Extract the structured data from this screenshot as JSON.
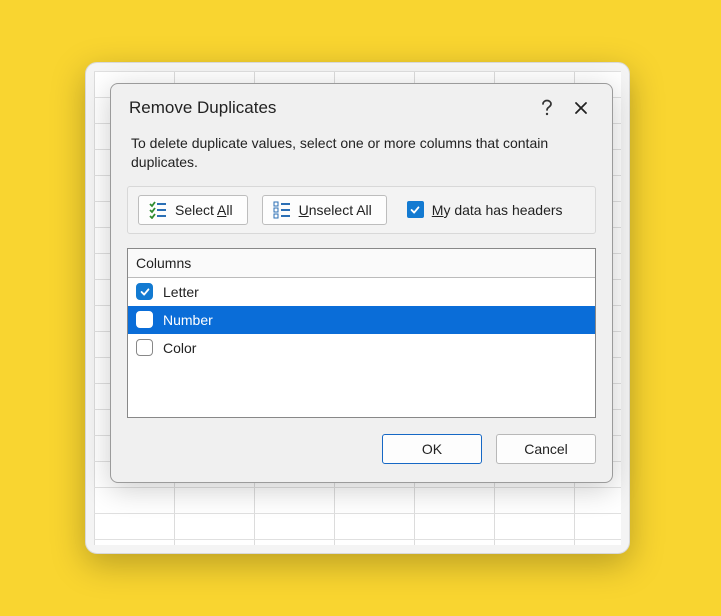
{
  "dialog": {
    "title": "Remove Duplicates",
    "instruction": "To delete duplicate values, select one or more columns that contain duplicates.",
    "select_all_prefix": "Select ",
    "select_all_key": "A",
    "select_all_suffix": "ll",
    "unselect_all_prefix": "",
    "unselect_all_key": "U",
    "unselect_all_suffix": "nselect All",
    "headers_prefix": "",
    "headers_key": "M",
    "headers_suffix": "y data has headers",
    "headers_checked": true,
    "columns_header": "Columns",
    "ok": "OK",
    "cancel": "Cancel"
  },
  "columns": [
    {
      "label": "Letter",
      "checked": true,
      "selected": false
    },
    {
      "label": "Number",
      "checked": false,
      "selected": true
    },
    {
      "label": "Color",
      "checked": false,
      "selected": false
    }
  ]
}
